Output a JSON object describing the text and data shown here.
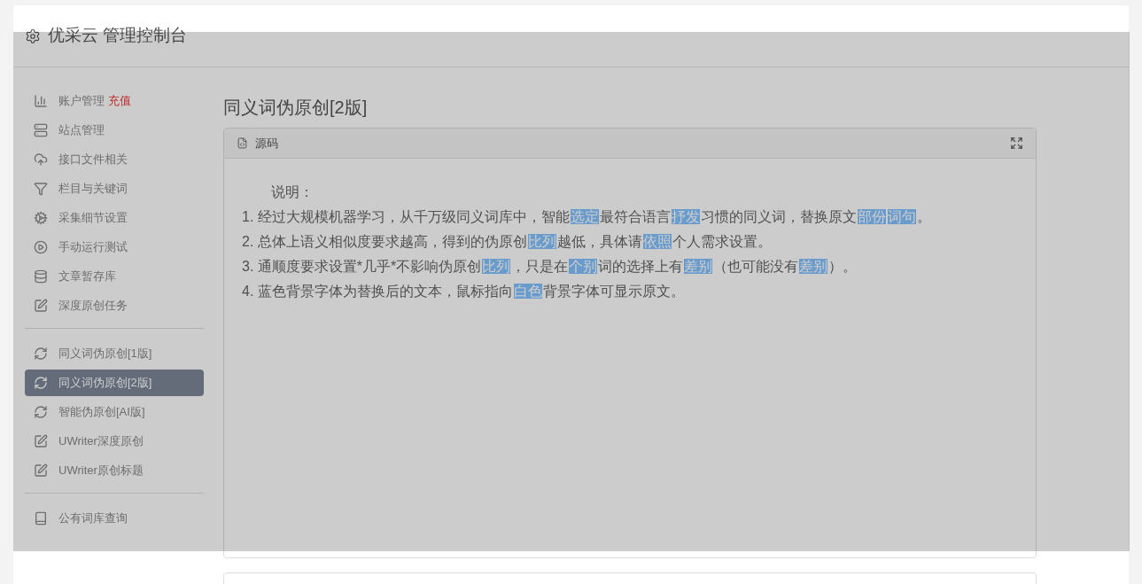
{
  "header": {
    "title": "优采云 管理控制台"
  },
  "sidebar": {
    "groups": [
      {
        "items": [
          {
            "label": "账户管理",
            "badge": "充值",
            "selected": false
          },
          {
            "label": "站点管理",
            "selected": false
          },
          {
            "label": "接口文件相关",
            "selected": false
          },
          {
            "label": "栏目与关键词",
            "selected": false
          },
          {
            "label": "采集细节设置",
            "selected": false
          },
          {
            "label": "手动运行测试",
            "selected": false
          },
          {
            "label": "文章暂存库",
            "selected": false
          },
          {
            "label": "深度原创任务",
            "selected": false
          }
        ]
      },
      {
        "items": [
          {
            "label": "同义词伪原创[1版]",
            "selected": false
          },
          {
            "label": "同义词伪原创[2版]",
            "selected": true
          },
          {
            "label": "智能伪原创[AI版]",
            "selected": false
          },
          {
            "label": "UWriter深度原创",
            "selected": false
          },
          {
            "label": "UWriter原创标题",
            "selected": false
          }
        ]
      },
      {
        "items": [
          {
            "label": "公有词库查询",
            "selected": false
          }
        ]
      }
    ]
  },
  "page_title": "同义词伪原创[2版]",
  "panel": {
    "tab": "源码",
    "heading": "说明：",
    "lines": [
      [
        {
          "text": "1. 经过大规模机器学习，从千万级同义词库中，智能",
          "highlighted": false
        },
        {
          "text": "选定",
          "highlighted": true
        },
        {
          "text": "最符合语言",
          "highlighted": false
        },
        {
          "text": "抒发",
          "highlighted": true
        },
        {
          "text": "习惯的同义词，替换原文",
          "highlighted": false
        },
        {
          "text": "部份",
          "highlighted": true
        },
        {
          "text": "词句",
          "highlighted": true
        },
        {
          "text": "。",
          "highlighted": false
        }
      ],
      [
        {
          "text": "2. 总体上语义相似度要求越高，得到的伪原创",
          "highlighted": false
        },
        {
          "text": "比列",
          "highlighted": true
        },
        {
          "text": "越低，具体请",
          "highlighted": false
        },
        {
          "text": "依照",
          "highlighted": true
        },
        {
          "text": "个人需求设置。",
          "highlighted": false
        }
      ],
      [
        {
          "text": "3. 通顺度要求设置*几乎*不影响伪原创",
          "highlighted": false
        },
        {
          "text": "比列",
          "highlighted": true
        },
        {
          "text": "，只是在",
          "highlighted": false
        },
        {
          "text": "个别",
          "highlighted": true
        },
        {
          "text": "词的选择上有",
          "highlighted": false
        },
        {
          "text": "差别",
          "highlighted": true
        },
        {
          "text": "（也可能没有",
          "highlighted": false
        },
        {
          "text": "差别",
          "highlighted": true
        },
        {
          "text": "）。",
          "highlighted": false
        }
      ],
      [
        {
          "text": "4. 蓝色背景字体为替换后的文本，鼠标指向",
          "highlighted": false
        },
        {
          "text": "白色",
          "highlighted": true
        },
        {
          "text": "背景字体可显示原文。",
          "highlighted": false
        }
      ]
    ]
  }
}
